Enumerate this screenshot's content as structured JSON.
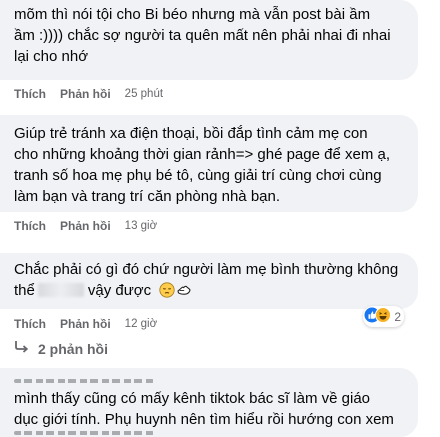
{
  "comments": [
    {
      "lines": [
        "mõm thì nói tội cho Bi béo nhưng mà vẫn post bài ầm",
        "ầm :)))) chắc sợ người ta quên mất nên phải nhai đi nhai",
        "lại cho nhớ"
      ],
      "like_label": "Thích",
      "reply_label": "Phản hồi",
      "time": "25 phút"
    },
    {
      "lines": [
        "Giúp trẻ tránh xa điện thoại, bồi đắp tình cảm mẹ con",
        "cho những khoảng thời gian rảnh=> ghé page để xem ạ,",
        "tranh số hoa mẹ phụ bé tô, cùng giải trí cùng chơi cùng",
        "làm bạn và trang trí căn phòng nhà bạn."
      ],
      "like_label": "Thích",
      "reply_label": "Phản hồi",
      "time": "13 giờ"
    },
    {
      "line1": "Chắc phải có gì đó chứ người làm mẹ bình thường không",
      "line2_before": "thể",
      "line2_after": "vậy được",
      "like_label": "Thích",
      "reply_label": "Phản hồi",
      "time": "12 giờ",
      "reaction_count": "2",
      "replies_label": "2 phản hồi"
    },
    {
      "lines": [
        "mình thấy cũng có mấy kênh tiktok bác sĩ làm về giáo",
        "dục giới tính. Phụ huynh nên tìm hiểu rồi hướng con xem"
      ]
    }
  ],
  "colors": {
    "bubble": "#f0f2f5",
    "meta": "#65676b",
    "like": "#1877f2",
    "haha": "#f7b125"
  },
  "icons": [
    "reply-arrow-icon",
    "like-reaction-icon",
    "haha-reaction-icon",
    "pensive-emoji-icon",
    "hand-emoji-icon"
  ]
}
